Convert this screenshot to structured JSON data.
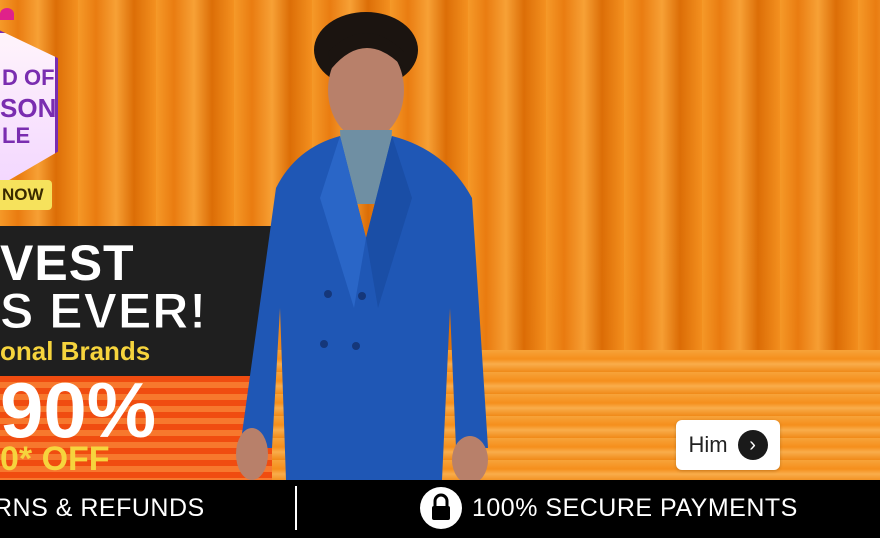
{
  "banner": {
    "badge_lines": [
      "D OF",
      "SON",
      "LE"
    ],
    "badge_cta": "NOW",
    "headline_1": "VEST",
    "headline_2": "S EVER!",
    "headline_3": "onal Brands",
    "discount": "90%",
    "discount_sub": "0* OFF"
  },
  "him_button": {
    "label": "Him",
    "arrow": "›"
  },
  "footer": {
    "left_text": "RNS & REFUNDS",
    "right_text": "100% SECURE PAYMENTS",
    "icon": "lock-icon"
  },
  "colors": {
    "banner_orange": "#f58a0f",
    "headline_yellow": "#f6d43d",
    "badge_purple": "#7a2db0",
    "footer_bg": "#000000"
  }
}
